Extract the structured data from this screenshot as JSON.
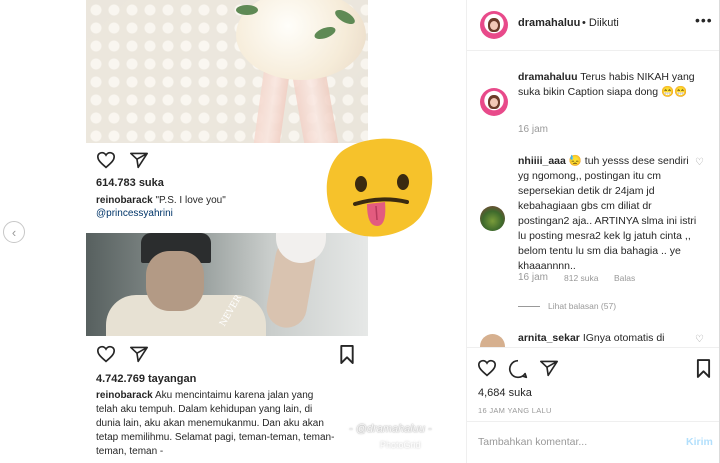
{
  "post": {
    "first_image": {
      "likes": "614.783 suka",
      "caption_user": "reinobarack",
      "caption_text": "\"P.S. I love you\"",
      "mention": "@princessyahrini"
    },
    "second_image": {
      "overlay_text": "NEVER",
      "views": "4.742.769 tayangan",
      "caption_user": "reinobarack",
      "caption_text": "Aku mencintaimu karena jalan yang telah aku tempuh. Dalam kehidupan yang lain, di dunia lain, aku akan menemukanmu. Dan aku akan tetap memilihmu. Selamat pagi, teman-teman, teman-teman, teman -"
    },
    "watermark": "- @dramahaluu -",
    "watermark2": "PhotoGrid"
  },
  "sidebar": {
    "header": {
      "username": "dramahaluu",
      "follow_status": "• Diikuti",
      "more": "•••"
    },
    "comments": [
      {
        "user": "dramahaluu",
        "text": "Terus habis NIKAH yang suka bikin Caption siapa dong 😁😁",
        "time": "16 jam"
      },
      {
        "user": "nhiiii_aaa",
        "text": "😓 tuh yesss dese sendiri yg ngomong,, postingan itu cm sepersekian detik dr 24jam jd kebahagiaan gbs cm diliat dr postingan2 aja.. ARTINYA slma ini istri lu posting mesra2 kek lg jatuh cinta ,, belom tentu lu sm dia bahagia .. ye khaaannnn..",
        "time": "16 jam",
        "likes": "812 suka",
        "reply": "Balas",
        "view_replies": "Lihat balasan (57)"
      },
      {
        "user": "arnita_sekar",
        "text": "IGnya otomatis di"
      }
    ],
    "likes": "4,684 suka",
    "date": "16 JAM YANG LALU",
    "add_comment_placeholder": "Tambahkan komentar...",
    "post_button": "Kirim"
  },
  "colors": {
    "avatar_ring": "#e84a8a",
    "link": "#003569",
    "post_button": "#b2dffc",
    "muted": "#999999"
  }
}
